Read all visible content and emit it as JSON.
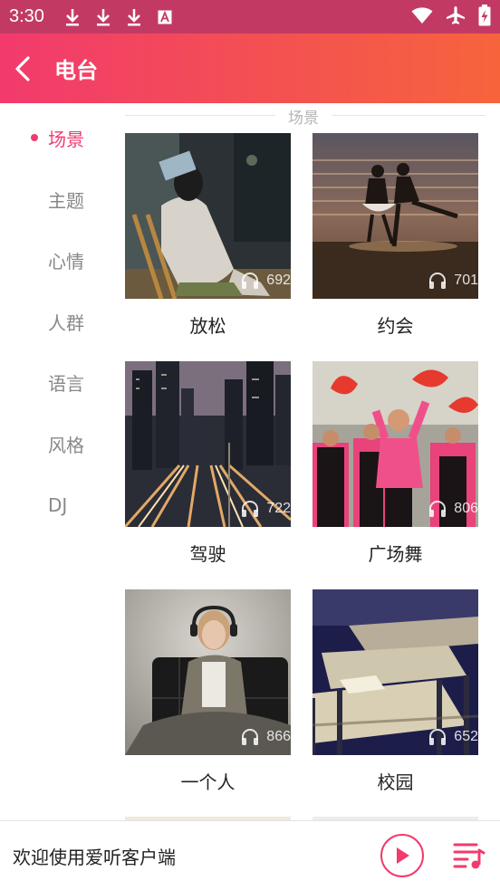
{
  "status_bar": {
    "time": "3:30",
    "icons": [
      "download-icon",
      "download-icon",
      "download-icon",
      "a-badge-icon",
      "wifi-icon",
      "airplane-icon",
      "battery-charging-icon"
    ]
  },
  "app_bar": {
    "title": "电台",
    "back_icon": "back-arrow-icon",
    "gradient_start": "#f23a6d",
    "gradient_end": "#f6643c"
  },
  "sidebar": {
    "items": [
      {
        "label": "场景",
        "active": true
      },
      {
        "label": "主题",
        "active": false
      },
      {
        "label": "心情",
        "active": false
      },
      {
        "label": "人群",
        "active": false
      },
      {
        "label": "语言",
        "active": false
      },
      {
        "label": "风格",
        "active": false
      },
      {
        "label": "DJ",
        "active": false
      }
    ]
  },
  "section": {
    "title": "场景"
  },
  "cards": [
    {
      "name": "放松",
      "plays": "692"
    },
    {
      "name": "约会",
      "plays": "701"
    },
    {
      "name": "驾驶",
      "plays": "722"
    },
    {
      "name": "广场舞",
      "plays": "806"
    },
    {
      "name": "一个人",
      "plays": "866"
    },
    {
      "name": "校园",
      "plays": "652"
    }
  ],
  "player": {
    "text": "欢迎使用爱听客户端",
    "play_icon": "play-icon",
    "playlist_icon": "playlist-music-icon",
    "accent": "#f23a6d"
  }
}
